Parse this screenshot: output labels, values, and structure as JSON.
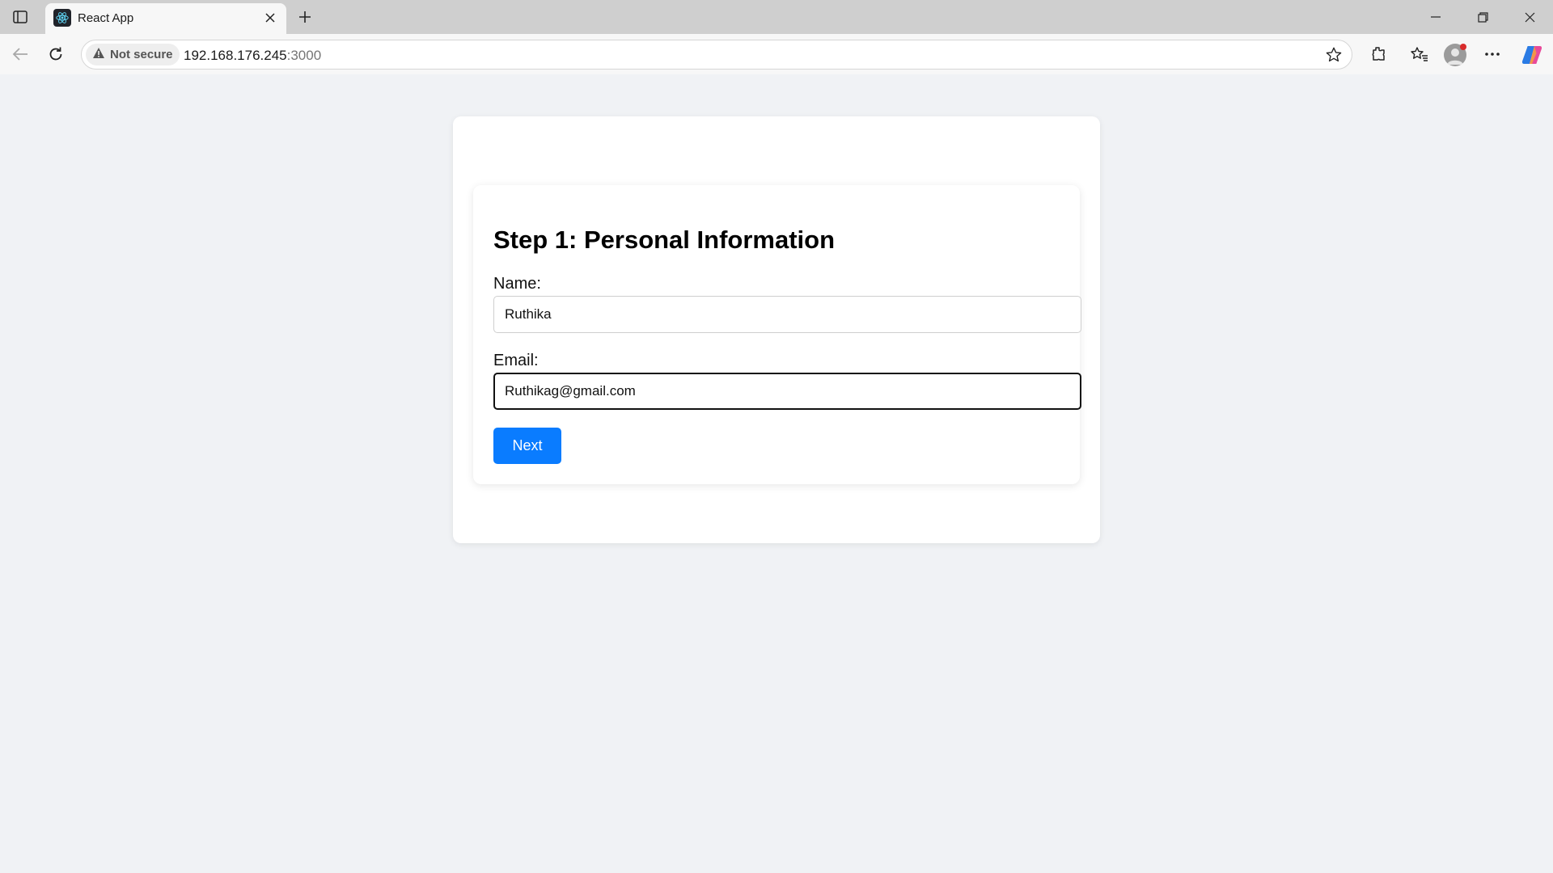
{
  "browser": {
    "tab": {
      "title": "React App",
      "favicon": "react-logo-icon"
    },
    "address_bar": {
      "security_label": "Not secure",
      "url_host": "192.168.176.245",
      "url_port": ":3000"
    },
    "colors": {
      "accent": "#0a7cff",
      "page_bg": "#f0f2f5"
    }
  },
  "form": {
    "title": "Step 1: Personal Information",
    "name_label": "Name:",
    "name_value": "Ruthika",
    "email_label": "Email:",
    "email_value": "Ruthikag@gmail.com",
    "next_label": "Next"
  }
}
